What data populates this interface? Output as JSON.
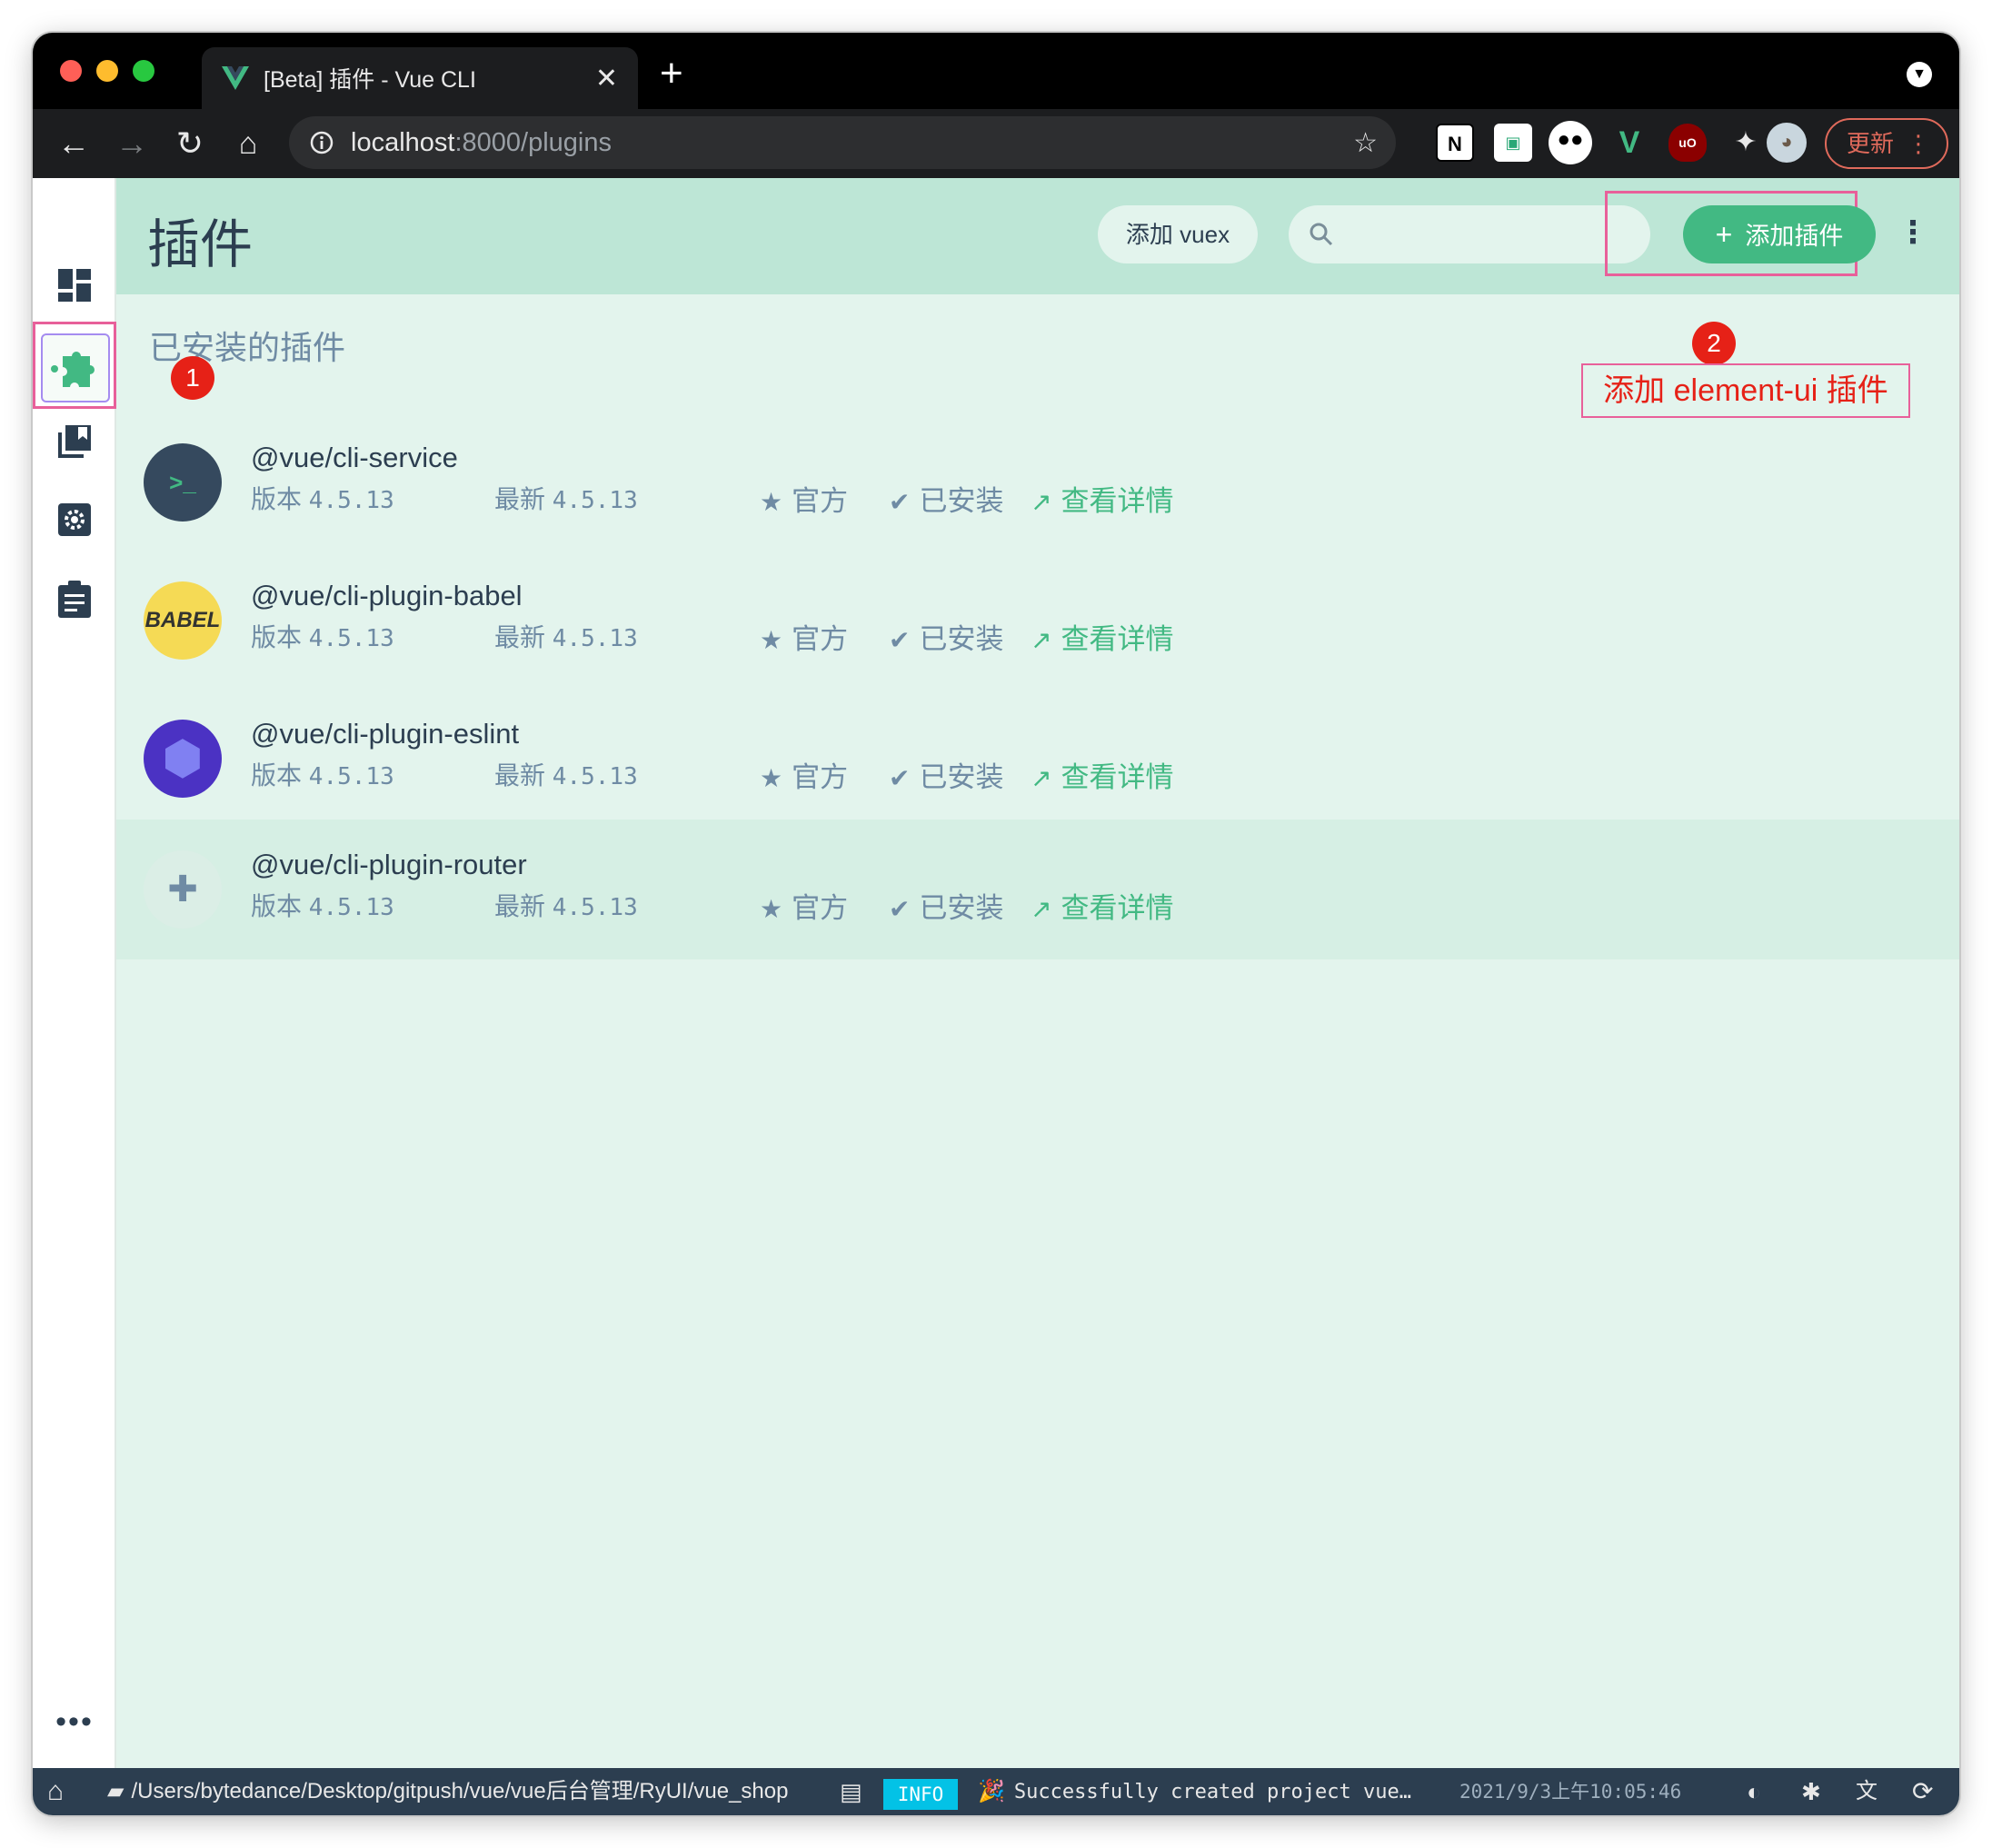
{
  "browser": {
    "tab_title": "[Beta] 插件 - Vue CLI",
    "tab_close": "✕",
    "new_tab": "+",
    "url_host": "localhost",
    "url_path": ":8000/plugins",
    "update_label": "更新",
    "extensions": [
      "notion-icon",
      "qr-extension-icon",
      "bitwarden-icon",
      "vue-devtools-icon",
      "ublock-icon",
      "puzzle-icon",
      "profile-avatar"
    ]
  },
  "sidebar": {
    "items": [
      "dashboard-icon",
      "plugins-icon",
      "dependencies-icon",
      "configuration-icon",
      "tasks-icon"
    ],
    "more": "•••"
  },
  "header": {
    "title": "插件",
    "vuex_button": "添加 vuex",
    "search_placeholder": "",
    "add_plugin_button": "添加插件",
    "add_plugin_icon": "+"
  },
  "main": {
    "section_title": "已安装的插件",
    "annotation_1": "1",
    "annotation_2": "2",
    "annotation_2_text": "添加 element-ui 插件"
  },
  "plugins": [
    {
      "name": "@vue/cli-service",
      "version_label": "版本",
      "version": "4.5.13",
      "latest_label": "最新",
      "latest": "4.5.13",
      "official": "官方",
      "installed": "已安装",
      "details": "查看详情",
      "logo": ">_"
    },
    {
      "name": "@vue/cli-plugin-babel",
      "version_label": "版本",
      "version": "4.5.13",
      "latest_label": "最新",
      "latest": "4.5.13",
      "official": "官方",
      "installed": "已安装",
      "details": "查看详情",
      "logo": "BABEL"
    },
    {
      "name": "@vue/cli-plugin-eslint",
      "version_label": "版本",
      "version": "4.5.13",
      "latest_label": "最新",
      "latest": "4.5.13",
      "official": "官方",
      "installed": "已安装",
      "details": "查看详情",
      "logo": "⬢"
    },
    {
      "name": "@vue/cli-plugin-router",
      "version_label": "版本",
      "version": "4.5.13",
      "latest_label": "最新",
      "latest": "4.5.13",
      "official": "官方",
      "installed": "已安装",
      "details": "查看详情",
      "logo": "✚"
    }
  ],
  "statusbar": {
    "path": "/Users/bytedance/Desktop/gitpush/vue/vue后台管理/RyUI/vue_shop",
    "level": "INFO",
    "message": "Successfully created project vue…",
    "time": "2021/9/3上午10:05:46"
  },
  "colors": {
    "accent": "#42b983",
    "header_bg": "#bde6d6",
    "content_bg": "#e3f4ed",
    "highlight": "#e8609a",
    "annotation": "#e62117"
  }
}
